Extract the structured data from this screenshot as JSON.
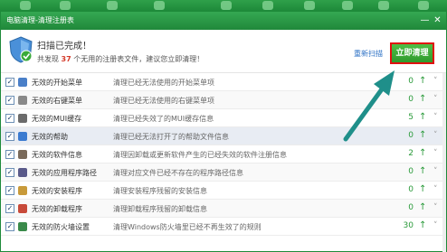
{
  "window": {
    "title": "电脑清理-清理注册表",
    "minimize_glyph": "—",
    "close_glyph": "✕"
  },
  "summary": {
    "title": "扫描已完成！",
    "sub_prefix": "共发现",
    "count": "37",
    "sub_suffix": "个无用的注册表文件，建议您立即清理！",
    "rescan_label": "重新扫描",
    "clean_button_label": "立即清理"
  },
  "rows": [
    {
      "checked": true,
      "icon": "start-menu-icon",
      "icon_color": "#4a7fc8",
      "name": "无效的开始菜单",
      "desc": "清理已经无法使用的开始菜单项",
      "count": "0"
    },
    {
      "checked": true,
      "icon": "context-menu-icon",
      "icon_color": "#8a8a8a",
      "name": "无效的右键菜单",
      "desc": "清理已经无法使用的右键菜单项",
      "count": "0"
    },
    {
      "checked": true,
      "icon": "speaker-icon",
      "icon_color": "#6b6b6b",
      "name": "无效的MUI缓存",
      "desc": "清理已经失效了的MUI缓存信息",
      "count": "5"
    },
    {
      "checked": true,
      "icon": "help-icon",
      "icon_color": "#3b7bd0",
      "name": "无效的帮助",
      "desc": "清理已经无法打开了的帮助文件信息",
      "count": "0"
    },
    {
      "checked": true,
      "icon": "software-icon",
      "icon_color": "#7a6a5a",
      "name": "无效的软件信息",
      "desc": "清理因卸载或更新软件产生的已经失效的软件注册信息",
      "count": "2"
    },
    {
      "checked": true,
      "icon": "app-path-icon",
      "icon_color": "#5a5a8a",
      "name": "无效的应用程序路径",
      "desc": "清理对应文件已经不存在的程序路径信息",
      "count": "0"
    },
    {
      "checked": true,
      "icon": "installer-icon",
      "icon_color": "#c89a3a",
      "name": "无效的安装程序",
      "desc": "清理安装程序残留的安装信息",
      "count": "0"
    },
    {
      "checked": true,
      "icon": "uninstaller-icon",
      "icon_color": "#c84a3a",
      "name": "无效的卸载程序",
      "desc": "清理卸载程序残留的卸载信息",
      "count": "0"
    },
    {
      "checked": true,
      "icon": "firewall-icon",
      "icon_color": "#3a8a4a",
      "name": "无效的防火墙设置",
      "desc": "清理Windows防火墙里已经不再生效了的规则",
      "count": "30"
    }
  ],
  "row_up_glyph": "↑",
  "row_chevron_glyph": "˅",
  "check_glyph": "✓",
  "colors": {
    "accent_green": "#2a9a3a",
    "highlight_red": "#e01010",
    "arrow_teal": "#1f8f8a"
  }
}
